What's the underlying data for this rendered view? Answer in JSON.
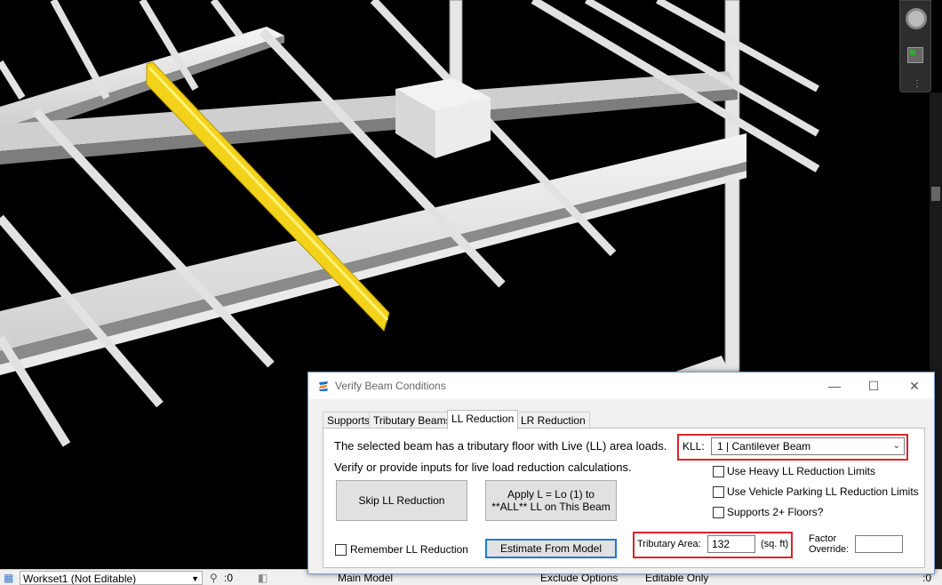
{
  "dialog": {
    "title": "Verify Beam Conditions",
    "window_buttons": {
      "minimize": "—",
      "maximize": "☐",
      "close": "✕"
    },
    "tabs": [
      {
        "label": "Supports",
        "active": false
      },
      {
        "label": "Tributary Beams",
        "active": false
      },
      {
        "label": "LL Reduction",
        "active": true
      },
      {
        "label": "LR Reduction",
        "active": false
      }
    ],
    "intro_line1": "The selected beam has a tributary floor with Live (LL) area loads.",
    "intro_line2": "Verify or provide inputs for live load reduction calculations.",
    "kll_label": "KLL:",
    "kll_value": "1  |  Cantilever Beam",
    "checkboxes": {
      "heavy": "Use Heavy LL Reduction Limits",
      "vehicle": "Use Vehicle Parking LL Reduction Limits",
      "floors": "Supports 2+ Floors?",
      "remember": "Remember LL Reduction"
    },
    "skip_button": "Skip LL Reduction",
    "apply_button": "Apply L = Lo (1) to\n**ALL** LL on This Beam",
    "estimate_button": "Estimate From Model",
    "trib_area_label": "Tributary Area:",
    "trib_area_value": "132",
    "trib_area_unit": "(sq. ft)",
    "factor_label_1": "Factor",
    "factor_label_2": "Override:",
    "factor_value": ""
  },
  "statusbar": {
    "workset": "Workset1 (Not Editable)",
    "count": ":0",
    "model": "Main Model",
    "exclude": "Exclude Options",
    "editable": "Editable Only",
    "filter_count": ":0"
  },
  "colors": {
    "selected_beam": "#f2d21b",
    "beam": "#d6d6d6",
    "highlight": "#d9262b",
    "focus": "#1e7bd6"
  }
}
